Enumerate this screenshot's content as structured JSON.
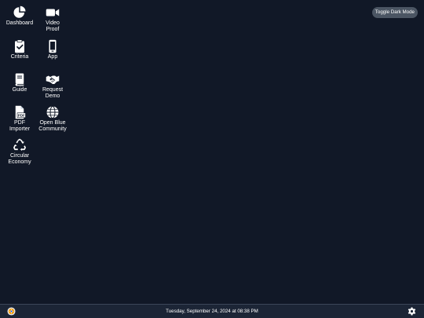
{
  "toolbar": {
    "toggle_label": "Toggle Dark Mode"
  },
  "apps": [
    {
      "label_lines": [
        "Dashboard"
      ],
      "icon": "pie-chart-icon"
    },
    {
      "label_lines": [
        "Video",
        "Proof"
      ],
      "icon": "video-camera-icon"
    },
    {
      "label_lines": [
        "Criteria"
      ],
      "icon": "clipboard-check-icon"
    },
    {
      "label_lines": [
        "App"
      ],
      "icon": "mobile-phone-icon"
    },
    {
      "label_lines": [
        "Guide"
      ],
      "icon": "book-icon"
    },
    {
      "label_lines": [
        "Request",
        "Demo"
      ],
      "icon": "handshake-icon"
    },
    {
      "label_lines": [
        "PDF",
        "Importer"
      ],
      "icon": "pdf-file-icon"
    },
    {
      "label_lines": [
        "Open Blue",
        "Community"
      ],
      "icon": "globe-icon"
    },
    {
      "label_lines": [
        "Circular",
        "Economy"
      ],
      "icon": "recycle-icon"
    }
  ],
  "taskbar": {
    "datetime": "Tuesday, September 24, 2024 at 08:38 PM",
    "start_icon": "start-logo-icon",
    "settings_icon": "gear-icon"
  },
  "colors": {
    "background": "#111827",
    "taskbar": "#1c2536",
    "toggle_button": "#4b5563",
    "text": "#ffffff"
  }
}
